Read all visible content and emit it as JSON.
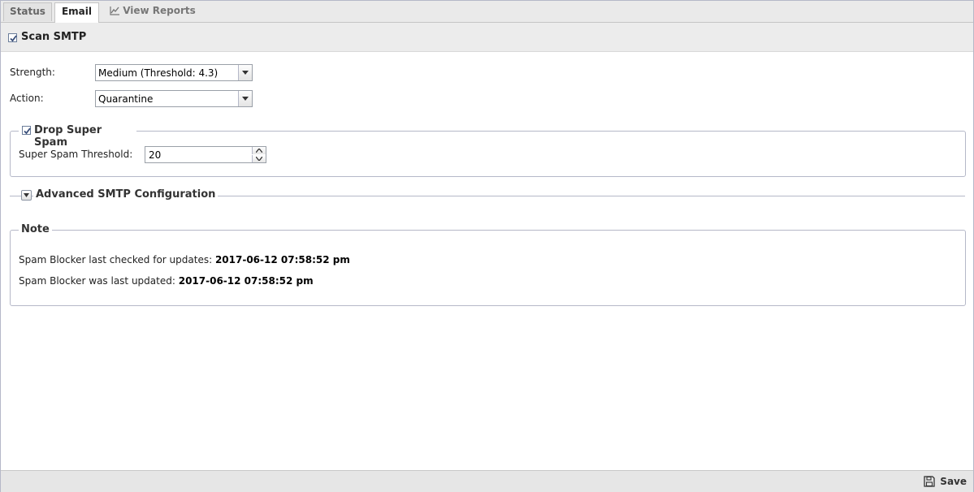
{
  "tabs": [
    {
      "label": "Status"
    },
    {
      "label": "Email"
    },
    {
      "label": "View Reports",
      "icon": "line-chart-icon"
    }
  ],
  "active_tab": "Email",
  "scan_smtp": {
    "label": "Scan SMTP",
    "checked": true
  },
  "form": {
    "strength_label": "Strength:",
    "strength_value": "Medium (Threshold: 4.3)",
    "action_label": "Action:",
    "action_value": "Quarantine"
  },
  "drop_super_spam": {
    "label": "Drop Super Spam",
    "checked": true,
    "threshold_label": "Super Spam Threshold:",
    "threshold_value": "20"
  },
  "advanced": {
    "label": "Advanced SMTP Configuration",
    "collapsed": true
  },
  "note": {
    "legend": "Note",
    "checked_label": "Spam Blocker last checked for updates:",
    "checked_value": "2017-06-12 07:58:52 pm",
    "updated_label": "Spam Blocker was last updated:",
    "updated_value": "2017-06-12 07:58:52 pm"
  },
  "footer": {
    "save_label": "Save",
    "save_icon": "floppy-disk-icon"
  },
  "colors": {
    "border": "#b5b8c8",
    "toolbar_bg": "#ececec",
    "check": "#3a4f7a"
  }
}
